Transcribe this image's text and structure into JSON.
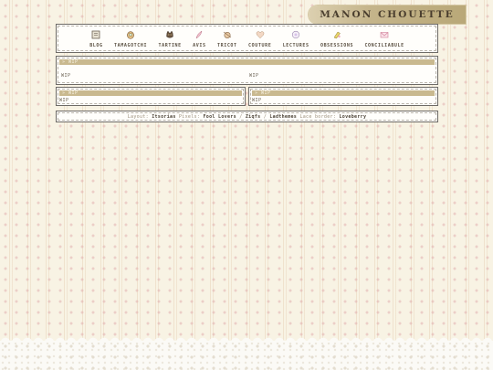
{
  "brand": {
    "title": "MANON CHOUETTE"
  },
  "nav": {
    "items": [
      {
        "label": "BLOG",
        "icon": "notebook-icon"
      },
      {
        "label": "TAMAGOTCHI",
        "icon": "tamagotchi-icon"
      },
      {
        "label": "TARTINE",
        "icon": "cat-icon"
      },
      {
        "label": "AVIS",
        "icon": "quill-icon"
      },
      {
        "label": "TRICOT",
        "icon": "knitting-icon"
      },
      {
        "label": "COUTURE",
        "icon": "heart-icon"
      },
      {
        "label": "LECTURES",
        "icon": "book-icon"
      },
      {
        "label": "OBSESSIONS",
        "icon": "sparkle-icon"
      },
      {
        "label": "CONCILIABULE",
        "icon": "envelope-icon"
      }
    ]
  },
  "main_panel": {
    "header": "WIP",
    "left_text": "WIP",
    "right_text": "WIP"
  },
  "left_panel": {
    "header": "WIP",
    "text": "WIP"
  },
  "right_panel": {
    "header": "WIP",
    "text": "WIP"
  },
  "footer": {
    "layout_label": "Layout:",
    "layout_author": "Itsorias",
    "pixels_label": "Pixels:",
    "pixels_author_1": "Fool Lovers",
    "sep_1": "/",
    "pixels_author_2": "Ziqfs",
    "sep_2": "/",
    "pixels_author_3": "Ladthemes",
    "lace_label": "Lace border:",
    "lace_author": "Loveberry"
  },
  "colors": {
    "accent": "#c9b98f",
    "brand_bar": "#c4b48a",
    "background": "#f8f3e4"
  }
}
